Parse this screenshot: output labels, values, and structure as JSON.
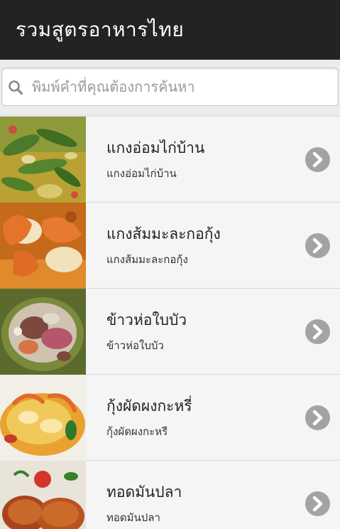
{
  "header": {
    "title": "รวมสูตรอาหารไทย"
  },
  "search": {
    "placeholder": "พิมพ์คำที่คุณต้องการค้นหา",
    "value": ""
  },
  "list": {
    "items": [
      {
        "name": "แกงอ่อมไก่บ้าน",
        "desc": "แกงอ่อมไก่บ้าน"
      },
      {
        "name": "แกงส้มมะละกอกุ้ง",
        "desc": "แกงส้มมะละกอกุ้ง"
      },
      {
        "name": "ข้าวห่อใบบัว",
        "desc": "ข้าวห่อใบบัว"
      },
      {
        "name": "กุ้งผัดผงกะหรี่",
        "desc": "กุ้งผัดผงกะหรี"
      },
      {
        "name": "ทอดมันปลา",
        "desc": "ทอดมันปลา"
      }
    ]
  },
  "colors": {
    "header_bg": "#232323",
    "row_bg": "#f5f5f5",
    "chevron": "#a3a3a3"
  },
  "icons": {
    "search": "search-icon",
    "chevron": "chevron-right-icon"
  }
}
